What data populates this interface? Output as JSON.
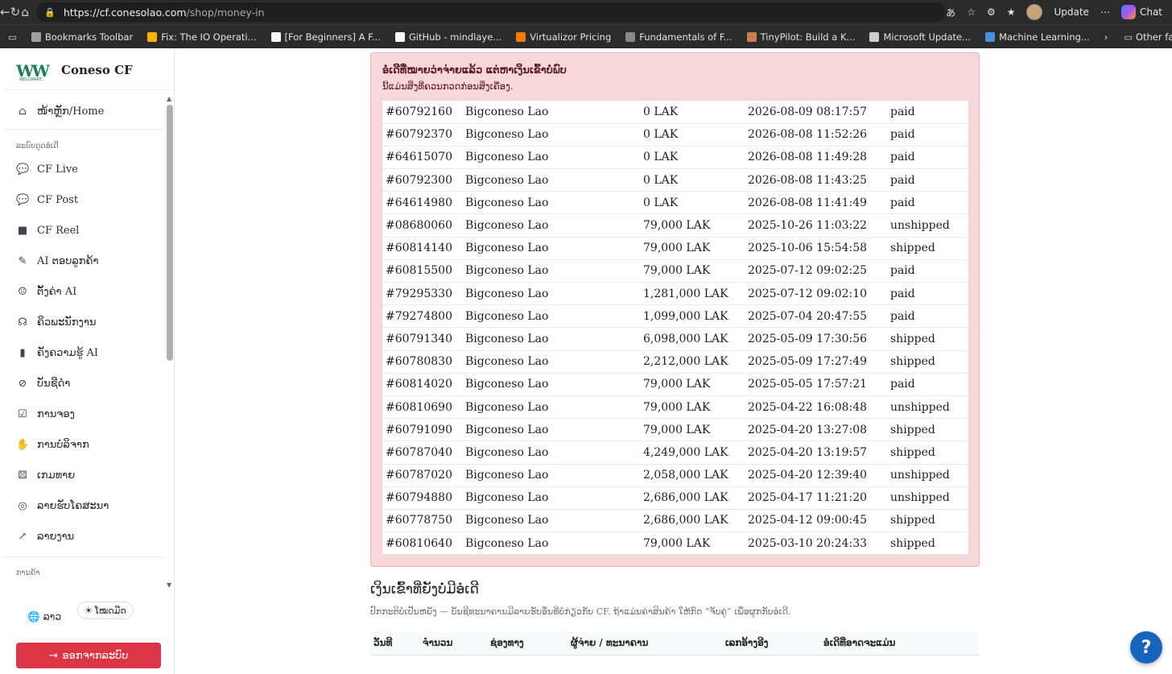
{
  "browser": {
    "url_host": "https://cf.conesolao.com",
    "url_path": "/shop/money-in",
    "update_label": "Update",
    "chat_label": "Chat",
    "bookmarks": [
      {
        "label": "Bookmarks Toolbar",
        "color": "#9aa0a6"
      },
      {
        "label": "Fix: The IO Operati...",
        "color": "#f4b400"
      },
      {
        "label": "[For Beginners] A F...",
        "color": "#ffffff"
      },
      {
        "label": "GitHub - mindlaye...",
        "color": "#ffffff"
      },
      {
        "label": "Virtualizor Pricing",
        "color": "#f57c00"
      },
      {
        "label": "Fundamentals of F...",
        "color": "#888888"
      },
      {
        "label": "TinyPilot: Build a K...",
        "color": "#c97d55"
      },
      {
        "label": "Microsoft Update...",
        "color": "#cccccc"
      },
      {
        "label": "Machine Learning...",
        "color": "#4a90d9"
      }
    ],
    "other_favorites": "Other favorite"
  },
  "sidebar": {
    "brand": "Coneso CF",
    "logo_sub": "WELLWARE",
    "home": "ໜ້າຫຼັກ/Home",
    "section_system": "ລະບົບດູດອໍເດີ",
    "items": [
      {
        "label": "CF Live",
        "icon": "comments-icon"
      },
      {
        "label": "CF Post",
        "icon": "comments-icon"
      },
      {
        "label": "CF Reel",
        "icon": "video-icon"
      },
      {
        "label": "AI ຕອບລູກຄ້າ",
        "icon": "magic-wand-icon"
      },
      {
        "label": "ຕັ້ງຄ່າ AI",
        "icon": "robot-icon"
      },
      {
        "label": "ຄິວພະນັກງານ",
        "icon": "headset-icon"
      },
      {
        "label": "ຄັງຄວາມຮູ້ AI",
        "icon": "book-icon"
      },
      {
        "label": "ບັນຊີດຳ",
        "icon": "user-slash-icon"
      },
      {
        "label": "ການຈອງ",
        "icon": "calendar-check-icon"
      },
      {
        "label": "ການບໍລິຈາກ",
        "icon": "hand-holding-icon"
      },
      {
        "label": "ເກມທາຍ",
        "icon": "dice-icon"
      },
      {
        "label": "ລາຍຮັບໂຄສະນາ",
        "icon": "coins-icon"
      },
      {
        "label": "ລາຍງານ",
        "icon": "chart-line-icon"
      }
    ],
    "section_settings": "ການຄ້າ",
    "lang": "ລາວ",
    "theme": "ໂໝດມືດ",
    "logout": "ອອກຈາກລະບົບ"
  },
  "alert": {
    "title": "ອໍເດີທີ່ໝາຍວ່າຈ່າຍແລ້ວ ແຕ່ຫາເງິນເຂົ້າບໍ່ພົບ",
    "subtitle": "ນີ້ແມ່ນສິ່ງທີ່ຄວນກວດກ່ອນສິ່ງເຄື່ອງ.",
    "rows": [
      {
        "id": "#60792160",
        "customer": "Bigconeso Lao",
        "amount": "0 LAK",
        "date": "2026-08-09 08:17:57",
        "status": "paid"
      },
      {
        "id": "#60792370",
        "customer": "Bigconeso Lao",
        "amount": "0 LAK",
        "date": "2026-08-08 11:52:26",
        "status": "paid"
      },
      {
        "id": "#64615070",
        "customer": "Bigconeso Lao",
        "amount": "0 LAK",
        "date": "2026-08-08 11:49:28",
        "status": "paid"
      },
      {
        "id": "#60792300",
        "customer": "Bigconeso Lao",
        "amount": "0 LAK",
        "date": "2026-08-08 11:43:25",
        "status": "paid"
      },
      {
        "id": "#64614980",
        "customer": "Bigconeso Lao",
        "amount": "0 LAK",
        "date": "2026-08-08 11:41:49",
        "status": "paid"
      },
      {
        "id": "#08680060",
        "customer": "Bigconeso Lao",
        "amount": "79,000 LAK",
        "date": "2025-10-26 11:03:22",
        "status": "unshipped"
      },
      {
        "id": "#60814140",
        "customer": "Bigconeso Lao",
        "amount": "79,000 LAK",
        "date": "2025-10-06 15:54:58",
        "status": "shipped"
      },
      {
        "id": "#60815500",
        "customer": "Bigconeso Lao",
        "amount": "79,000 LAK",
        "date": "2025-07-12 09:02:25",
        "status": "paid"
      },
      {
        "id": "#79295330",
        "customer": "Bigconeso Lao",
        "amount": "1,281,000 LAK",
        "date": "2025-07-12 09:02:10",
        "status": "paid"
      },
      {
        "id": "#79274800",
        "customer": "Bigconeso Lao",
        "amount": "1,099,000 LAK",
        "date": "2025-07-04 20:47:55",
        "status": "paid"
      },
      {
        "id": "#60791340",
        "customer": "Bigconeso Lao",
        "amount": "6,098,000 LAK",
        "date": "2025-05-09 17:30:56",
        "status": "shipped"
      },
      {
        "id": "#60780830",
        "customer": "Bigconeso Lao",
        "amount": "2,212,000 LAK",
        "date": "2025-05-09 17:27:49",
        "status": "shipped"
      },
      {
        "id": "#60814020",
        "customer": "Bigconeso Lao",
        "amount": "79,000 LAK",
        "date": "2025-05-05 17:57:21",
        "status": "paid"
      },
      {
        "id": "#60810690",
        "customer": "Bigconeso Lao",
        "amount": "79,000 LAK",
        "date": "2025-04-22 16:08:48",
        "status": "unshipped"
      },
      {
        "id": "#60791090",
        "customer": "Bigconeso Lao",
        "amount": "79,000 LAK",
        "date": "2025-04-20 13:27:08",
        "status": "shipped"
      },
      {
        "id": "#60787040",
        "customer": "Bigconeso Lao",
        "amount": "4,249,000 LAK",
        "date": "2025-04-20 13:19:57",
        "status": "shipped"
      },
      {
        "id": "#60787020",
        "customer": "Bigconeso Lao",
        "amount": "2,058,000 LAK",
        "date": "2025-04-20 12:39:40",
        "status": "unshipped"
      },
      {
        "id": "#60794880",
        "customer": "Bigconeso Lao",
        "amount": "2,686,000 LAK",
        "date": "2025-04-17 11:21:20",
        "status": "unshipped"
      },
      {
        "id": "#60778750",
        "customer": "Bigconeso Lao",
        "amount": "2,686,000 LAK",
        "date": "2025-04-12 09:00:45",
        "status": "shipped"
      },
      {
        "id": "#60810640",
        "customer": "Bigconeso Lao",
        "amount": "79,000 LAK",
        "date": "2025-03-10 20:24:33",
        "status": "shipped"
      }
    ]
  },
  "unmatched": {
    "title": "ເງິນເຂົ້າທີ່ຍັງບໍ່ມີອໍເດີ",
    "description": "ປົກກະຕິບໍ່ເປັນຫຍັງ — ບັນຊີທະນາຄານມີລາຍຮັບອື່ນທີ່ບໍ່ກ່ຽວກັບ CF. ຖ້າແມ່ນຄ່າສິນຄ້າ ໃຫ້ກົດ “ຈັບຄູ່” ເພື່ອຜູກກັບອໍເດີ.",
    "columns": [
      "ວັນທີ",
      "ຈຳນວນ",
      "ຊ່ອງທາງ",
      "ຜູ້ຈ່າຍ / ທະນາຄານ",
      "ເລກອ້າງອີງ",
      "ອໍເດີທີ່ອາດຈະແມ່ນ"
    ]
  },
  "help_label": "?"
}
